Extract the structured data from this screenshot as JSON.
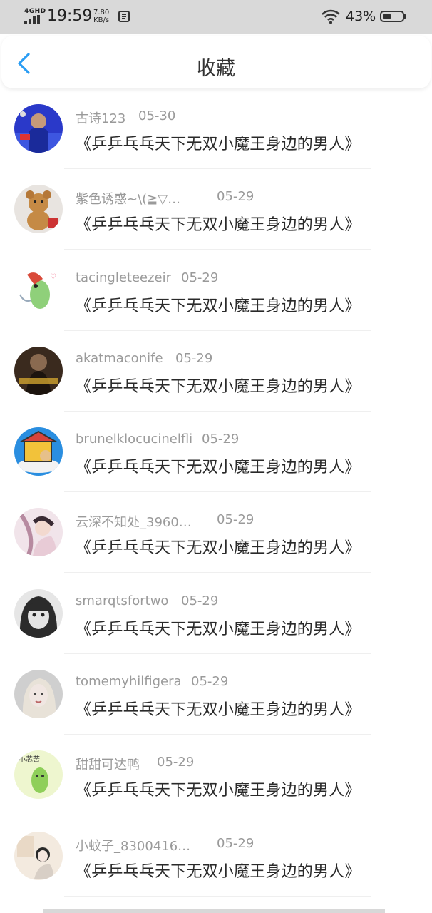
{
  "status_bar": {
    "network": "4GHD",
    "time": "19:59",
    "speed_value": "7.80",
    "speed_unit": "KB/s",
    "battery_percent": "43%",
    "battery_level": 0.43
  },
  "header": {
    "title": "收藏",
    "back_icon": "chevron-left-icon",
    "accent_color": "#2a9df4"
  },
  "items": [
    {
      "username": "古诗123",
      "date": "05-30",
      "title": "《乒乒乓乓天下无双小魔王身边的男人》",
      "avatar": "avatar-photo-blue"
    },
    {
      "username": "紫色诱惑~\\(≧▽…",
      "date": "05-29",
      "title": "《乒乒乓乓天下无双小魔王身边的男人》",
      "avatar": "avatar-teddy-bear"
    },
    {
      "username": "tacingleteezeir",
      "date": "05-29",
      "title": "《乒乒乓乓天下无双小魔王身边的男人》",
      "avatar": "avatar-green-cartoon"
    },
    {
      "username": "akatmaconife",
      "date": "05-29",
      "title": "《乒乒乓乓天下无双小魔王身边的男人》",
      "avatar": "avatar-dark-photo"
    },
    {
      "username": "brunelklocucinelfli",
      "date": "05-29",
      "title": "《乒乒乓乓天下无双小魔王身边的男人》",
      "avatar": "avatar-cartoon-house"
    },
    {
      "username": "云深不知处_3960…",
      "date": "05-29",
      "title": "《乒乒乓乓天下无双小魔王身边的男人》",
      "avatar": "avatar-anime-girl"
    },
    {
      "username": "smarqtsfortwo",
      "date": "05-29",
      "title": "《乒乒乓乓天下无双小魔王身边的男人》",
      "avatar": "avatar-bw-girl"
    },
    {
      "username": "tomemyhilfigera",
      "date": "05-29",
      "title": "《乒乒乓乓天下无双小魔王身边的男人》",
      "avatar": "avatar-blonde-girl"
    },
    {
      "username": "甜甜可达鸭",
      "date": "05-29",
      "title": "《乒乒乓乓天下无双小魔王身边的男人》",
      "avatar": "avatar-green-bean"
    },
    {
      "username": "小蚊子_8300416…",
      "date": "05-29",
      "title": "《乒乒乓乓天下无双小魔王身边的男人》",
      "avatar": "avatar-sketch-girl"
    }
  ]
}
